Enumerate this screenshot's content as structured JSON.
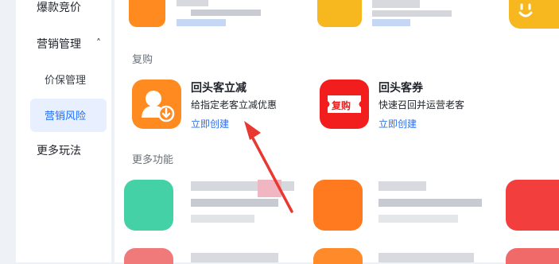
{
  "sidebar": {
    "items": [
      {
        "label": "爆款竞价"
      },
      {
        "label": "营销管理"
      },
      {
        "label": "价保管理"
      },
      {
        "label": "营销风险"
      },
      {
        "label": "更多玩法"
      }
    ],
    "active_index": 3
  },
  "sections": {
    "repurchase": {
      "title": "复购",
      "cards": [
        {
          "title": "回头客立减",
          "desc": "给指定老客立减优惠",
          "action": "立即创建",
          "icon": "person-download-icon",
          "color": "#ff8a1f"
        },
        {
          "title": "回头客券",
          "desc": "快速召回并运营老客",
          "action": "立即创建",
          "icon": "repurchase-coupon-icon",
          "badge": "复购",
          "color": "#f21d1d"
        }
      ]
    },
    "more": {
      "title": "更多功能"
    }
  },
  "colors": {
    "accent": "#2f6fed",
    "active_bg": "#e8f0ff",
    "arrow": "#e8382f"
  }
}
